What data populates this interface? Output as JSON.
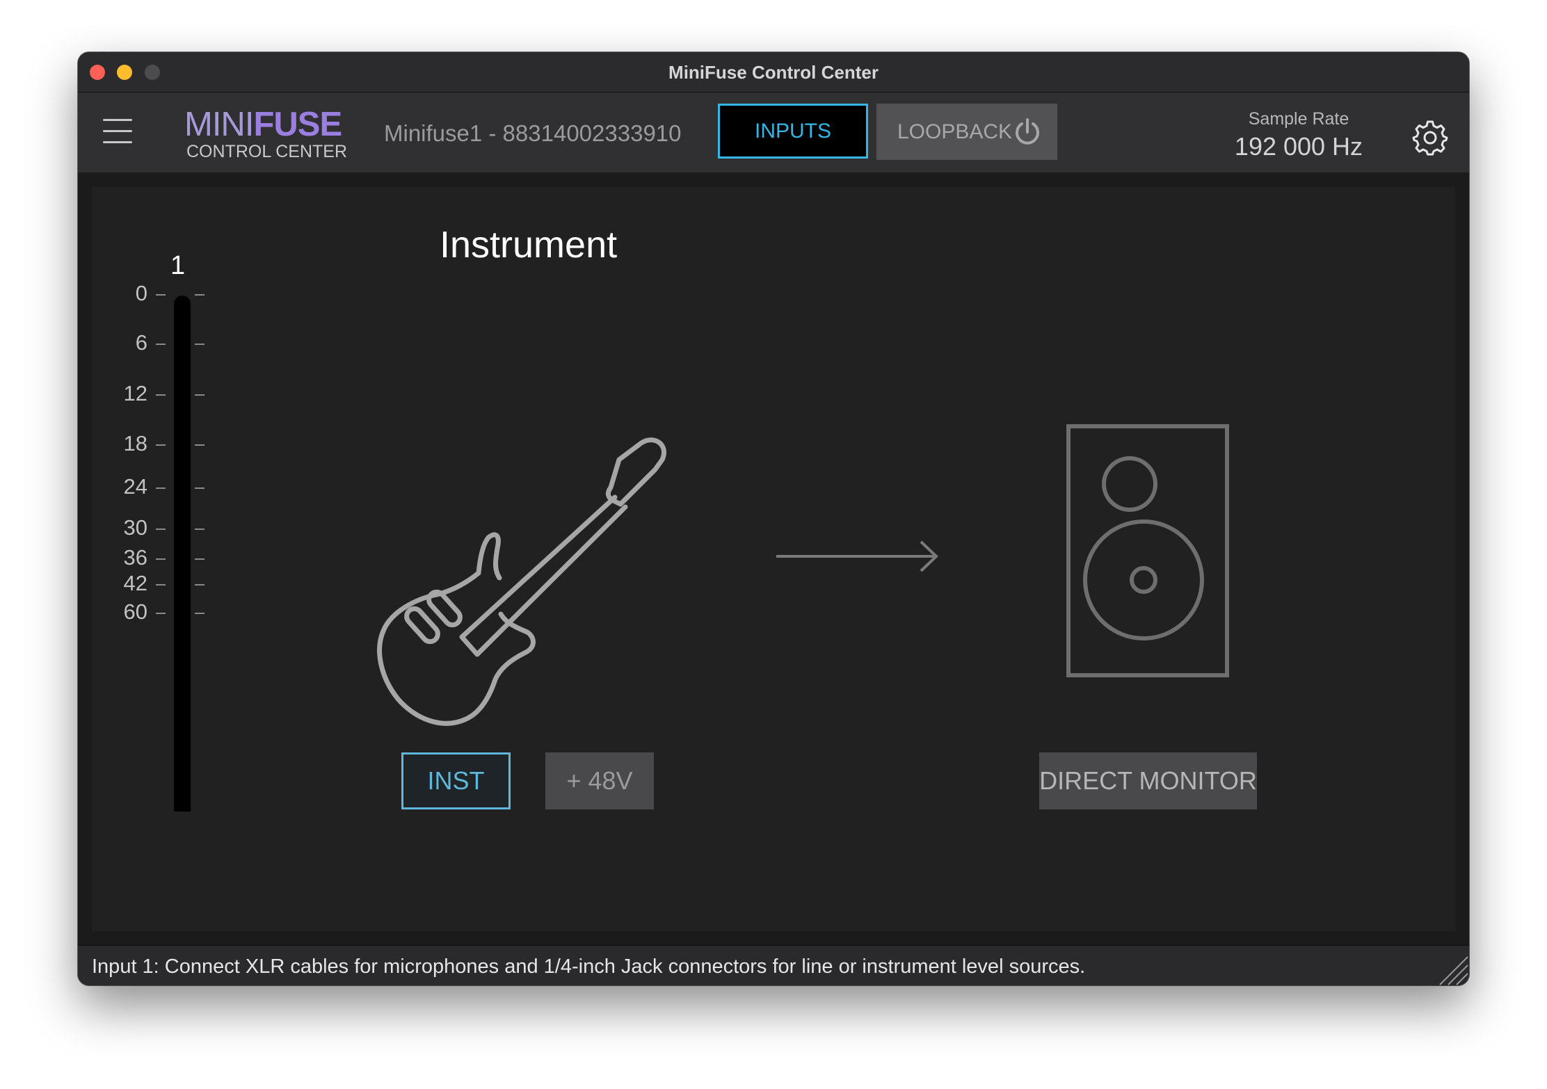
{
  "window": {
    "title": "MiniFuse Control Center"
  },
  "header": {
    "logo_main_a": "MINI",
    "logo_main_b": "FUSE",
    "logo_sub": "CONTROL CENTER",
    "device_name": "Minifuse1 - 88314002333910",
    "inputs_label": "INPUTS",
    "loopback_label": "LOOPBACK",
    "sample_rate_label": "Sample Rate",
    "sample_rate_value": "192 000 Hz",
    "icons": [
      "menu-icon",
      "power-icon",
      "gear-icon"
    ]
  },
  "meter": {
    "channel": "1",
    "scale": [
      "0",
      "6",
      "12",
      "18",
      "24",
      "30",
      "36",
      "42",
      "60"
    ],
    "level": 0
  },
  "input_panel": {
    "title": "Instrument",
    "inst_label": "INST",
    "phantom_label": "+ 48V",
    "direct_monitor_label": "DIRECT MONITOR",
    "inst_active": true
  },
  "status": {
    "text": "Input 1: Connect XLR cables for microphones and 1/4-inch Jack connectors for line or instrument level sources."
  },
  "colors": {
    "accent": "#35b7e6",
    "logo_purple": "#9a7fe0",
    "background": "#212121"
  }
}
